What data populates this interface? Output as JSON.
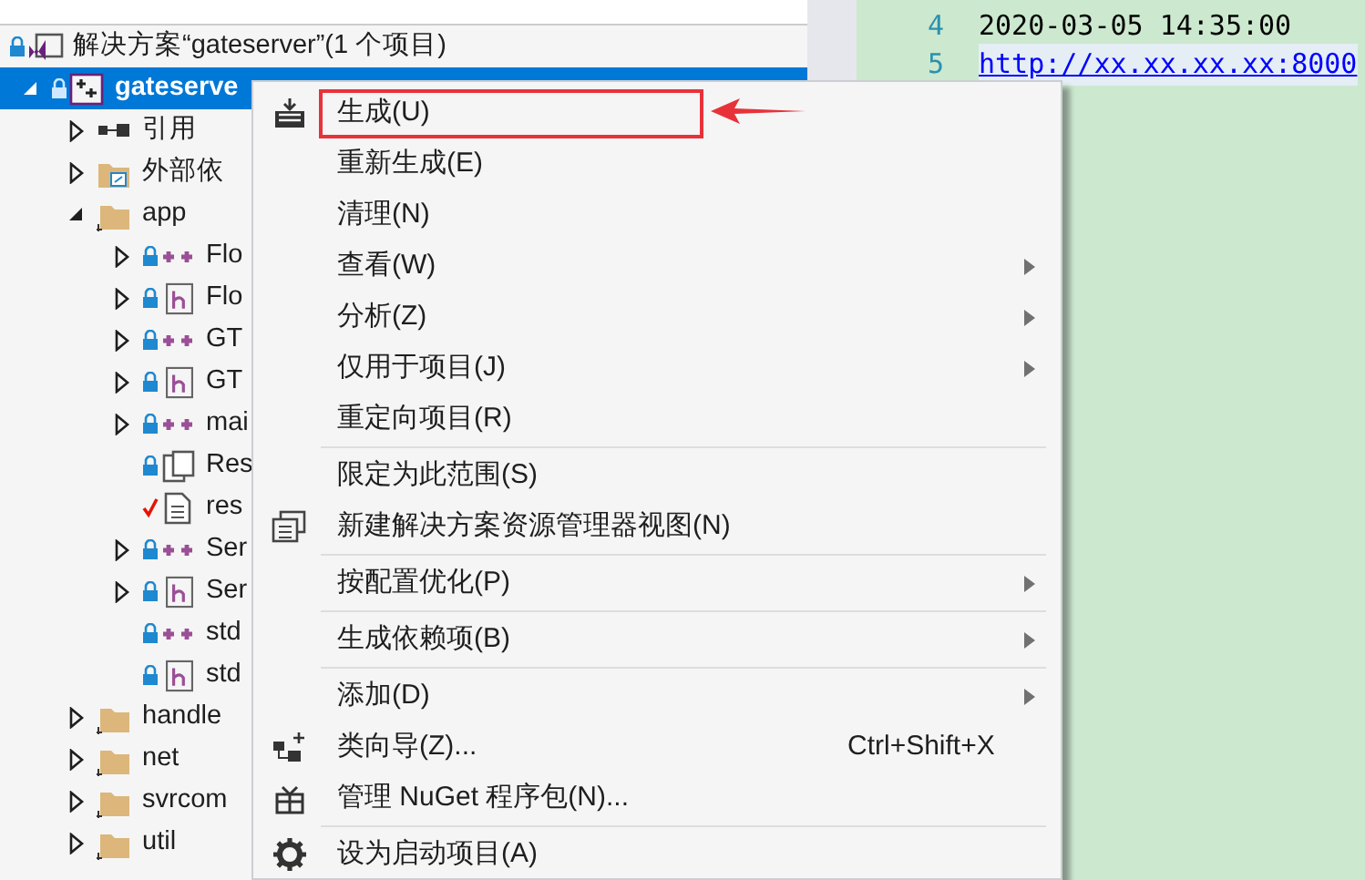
{
  "solution_explorer": {
    "tree": [
      {
        "label": "解决方案“gateserver”(1 个项目)",
        "kind": "solution",
        "locked": true,
        "selected": false,
        "children": [
          {
            "label": "gateserve",
            "kind": "project",
            "locked": true,
            "expanded": true,
            "selected": true,
            "children": [
              {
                "label": "引用",
                "kind": "references",
                "expanded": false,
                "selected": false
              },
              {
                "label": "外部依",
                "kind": "external",
                "expanded": false,
                "selected": false
              },
              {
                "label": "app",
                "kind": "folder",
                "expanded": true,
                "selected": false,
                "children": [
                  {
                    "label": "Flo",
                    "kind": "cpp",
                    "locked": true,
                    "expanded": false,
                    "selected": false
                  },
                  {
                    "label": "Flo",
                    "kind": "header",
                    "locked": true,
                    "expanded": false,
                    "selected": false
                  },
                  {
                    "label": "GT",
                    "kind": "cpp",
                    "locked": true,
                    "expanded": false,
                    "selected": false
                  },
                  {
                    "label": "GT",
                    "kind": "header",
                    "locked": true,
                    "expanded": false,
                    "selected": false
                  },
                  {
                    "label": "mai",
                    "kind": "cpp",
                    "locked": true,
                    "expanded": false,
                    "selected": false
                  },
                  {
                    "label": "Res",
                    "kind": "resource",
                    "locked": true,
                    "selected": false
                  },
                  {
                    "label": "res",
                    "kind": "file",
                    "checked_out": true,
                    "selected": false
                  },
                  {
                    "label": "Ser",
                    "kind": "cpp",
                    "locked": true,
                    "expanded": false,
                    "selected": false
                  },
                  {
                    "label": "Ser",
                    "kind": "header",
                    "locked": true,
                    "expanded": false,
                    "selected": false
                  },
                  {
                    "label": "std",
                    "kind": "cpp",
                    "locked": true,
                    "selected": false
                  },
                  {
                    "label": "std",
                    "kind": "header",
                    "locked": true,
                    "selected": false
                  }
                ]
              },
              {
                "label": "handle",
                "kind": "folder",
                "expanded": false,
                "selected": false
              },
              {
                "label": "net",
                "kind": "folder",
                "expanded": false,
                "selected": false
              },
              {
                "label": "svrcom",
                "kind": "folder",
                "expanded": false,
                "selected": false
              },
              {
                "label": "util",
                "kind": "folder",
                "expanded": false,
                "selected": false
              }
            ]
          }
        ]
      }
    ]
  },
  "editor": {
    "lines": [
      {
        "number": "4",
        "text": "2020-03-05 14:35:00",
        "kind": "plain"
      },
      {
        "number": "5",
        "text": "http://xx.xx.xx.xx:8000",
        "kind": "link"
      }
    ]
  },
  "context_menu": {
    "items": [
      {
        "kind": "build",
        "label": "生成(U)",
        "highlighted": true
      },
      {
        "kind": "item",
        "label": "重新生成(E)"
      },
      {
        "kind": "item",
        "label": "清理(N)"
      },
      {
        "kind": "item",
        "label": "查看(W)",
        "submenu": true
      },
      {
        "kind": "item",
        "label": "分析(Z)",
        "submenu": true
      },
      {
        "kind": "item",
        "label": "仅用于项目(J)",
        "submenu": true
      },
      {
        "kind": "item",
        "label": "重定向项目(R)"
      },
      {
        "kind": "separator"
      },
      {
        "kind": "item",
        "label": "限定为此范围(S)"
      },
      {
        "kind": "view",
        "label": "新建解决方案资源管理器视图(N)"
      },
      {
        "kind": "separator"
      },
      {
        "kind": "item",
        "label": "按配置优化(P)",
        "submenu": true
      },
      {
        "kind": "separator"
      },
      {
        "kind": "item",
        "label": "生成依赖项(B)",
        "submenu": true
      },
      {
        "kind": "separator"
      },
      {
        "kind": "item",
        "label": "添加(D)",
        "submenu": true
      },
      {
        "kind": "wizard",
        "label": "类向导(Z)...",
        "shortcut": "Ctrl+Shift+X"
      },
      {
        "kind": "package",
        "label": "管理 NuGet 程序包(N)..."
      },
      {
        "kind": "separator"
      },
      {
        "kind": "gear",
        "label": "设为启动项目(A)"
      }
    ]
  },
  "annotation": {
    "arrow": true
  }
}
